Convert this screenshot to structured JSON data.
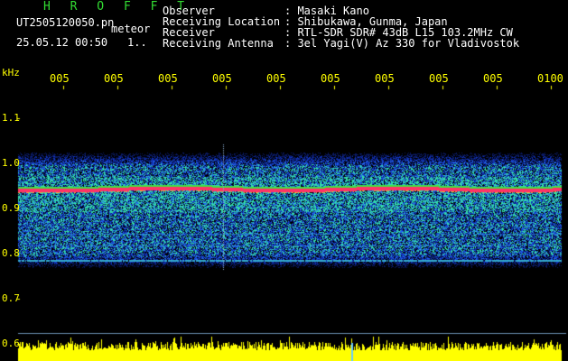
{
  "header": {
    "program": "H R O F F T",
    "filename": "UT2505120050.pn",
    "mode": "meteor",
    "datetime": "25.05.12 00:50",
    "index": "1..",
    "fields": [
      {
        "label": "Observer",
        "value": ": Masaki Kano"
      },
      {
        "label": "Receiving Location",
        "value": ": Shibukawa, Gunma, Japan"
      },
      {
        "label": "Receiver",
        "value": ": RTL-SDR SDR# 43dB L15 103.2MHz CW"
      },
      {
        "label": "Receiving Antenna",
        "value": ": 3el Yagi(V) Az 330 for Vladivostok"
      }
    ]
  },
  "axis": {
    "unit": "kHz",
    "y_labels": [
      "1.1",
      "1.0",
      "0.9",
      "0.8",
      "0.7",
      "0.6"
    ],
    "time_labels": [
      "005",
      "005",
      "005",
      "005",
      "005",
      "005",
      "005",
      "005",
      "005",
      "0100"
    ]
  },
  "colors": {
    "text": "#ffffff",
    "title": "#33dd33",
    "axis_labels": "#ffff00",
    "carrier_line": "#ff3366",
    "signal_bar": "#ffff00",
    "background": "#000000"
  }
}
